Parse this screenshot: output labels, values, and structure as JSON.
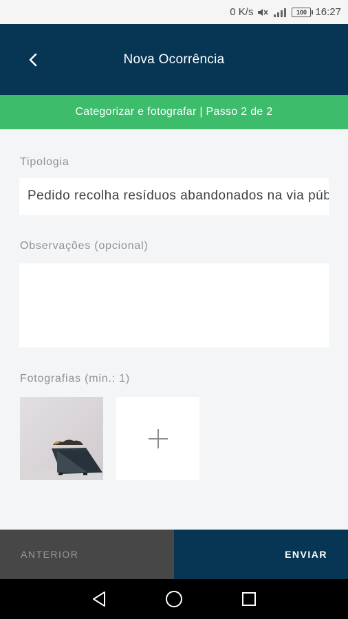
{
  "status_bar": {
    "net_speed": "0 K/s",
    "battery": "100",
    "time": "16:27",
    "icons": [
      "mute-icon",
      "signal-icon",
      "battery-icon"
    ]
  },
  "app_bar": {
    "title": "Nova Ocorrência",
    "back_icon": "chevron-left-icon",
    "background": "#063654"
  },
  "step_bar": {
    "text": "Categorizar e fotografar | Passo 2 de 2",
    "background": "#3dbd6b"
  },
  "form": {
    "tipologia_label": "Tipologia",
    "tipologia_value": "Pedido recolha resíduos abandonados na via pública",
    "observacoes_label": "Observações (opcional)",
    "observacoes_value": "",
    "fotografias_label": "Fotografias (min.: 1)",
    "photos": [
      "waste-container-photo"
    ],
    "add_photo_icon": "plus-icon"
  },
  "footer": {
    "previous_label": "ANTERIOR",
    "send_label": "ENVIAR"
  },
  "nav": {
    "icons": [
      "back-triangle-icon",
      "home-circle-icon",
      "recents-square-icon"
    ]
  }
}
